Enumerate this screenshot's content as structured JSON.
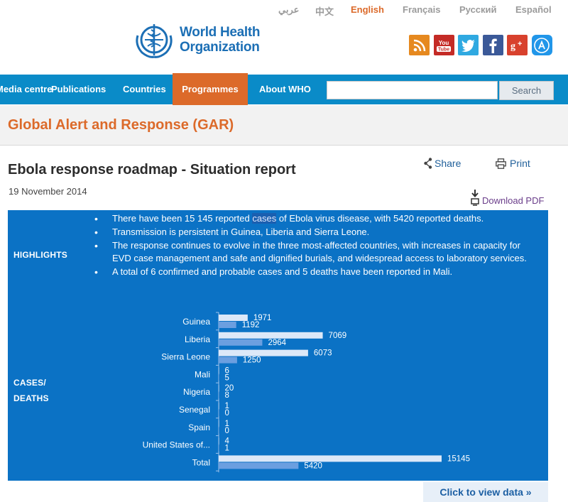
{
  "languages": [
    {
      "label": "عربي",
      "active": false
    },
    {
      "label": "中文",
      "active": false
    },
    {
      "label": "English",
      "active": true
    },
    {
      "label": "Français",
      "active": false
    },
    {
      "label": "Русский",
      "active": false
    },
    {
      "label": "Español",
      "active": false
    }
  ],
  "logo": {
    "line1": "World Health",
    "line2": "Organization"
  },
  "social": [
    {
      "icon": "rss-icon",
      "glyph": "◝"
    },
    {
      "icon": "youtube-icon",
      "glyph": "You"
    },
    {
      "icon": "twitter-icon",
      "glyph": "🐦"
    },
    {
      "icon": "facebook-icon",
      "glyph": "f"
    },
    {
      "icon": "google-plus-icon",
      "glyph": "g+"
    },
    {
      "icon": "app-store-icon",
      "glyph": "A"
    }
  ],
  "nav": {
    "items": [
      "Media centre",
      "Publications",
      "Countries",
      "Programmes",
      "About WHO"
    ],
    "active": "Programmes",
    "search_placeholder": "",
    "search_button": "Search"
  },
  "section_title": "Global Alert and Response (GAR)",
  "article": {
    "title": "Ebola response roadmap - Situation report",
    "date": "19 November 2014",
    "share": "Share",
    "print": "Print",
    "download": "Download PDF"
  },
  "highlights": {
    "label": "HIGHLIGHTS",
    "bullets": [
      {
        "before": "There have been 15 145 reported ",
        "highlight": "cases",
        "after": " of Ebola virus disease, with 5420 reported deaths."
      },
      {
        "before": "Transmission is persistent in Guinea, Liberia and Sierra Leone.",
        "highlight": "",
        "after": ""
      },
      {
        "before": "The response continues to evolve in the three most-affected countries, with increases in capacity for EVD case management and safe and dignified burials, and widespread access to laboratory services.",
        "highlight": "",
        "after": ""
      },
      {
        "before": "A total of 6 confirmed and probable cases and 5 deaths have been reported in Mali.",
        "highlight": "",
        "after": ""
      }
    ]
  },
  "cases_label_1": "CASES/",
  "cases_label_2": "DEATHS",
  "colors": {
    "cases_bar": "#dce8f8",
    "deaths_bar": "#6b9fe0",
    "panel": "#0b72c5",
    "accent": "#dc6a2a"
  },
  "chart_data": {
    "type": "bar",
    "orientation": "horizontal",
    "categories": [
      "Guinea",
      "Liberia",
      "Sierra Leone",
      "Mali",
      "Nigeria",
      "Senegal",
      "Spain",
      "United States of...",
      "Total"
    ],
    "series": [
      {
        "values": [
          1971,
          7069,
          6073,
          6,
          20,
          1,
          1,
          4,
          15145
        ]
      },
      {
        "values": [
          1192,
          2964,
          1250,
          5,
          8,
          0,
          0,
          1,
          5420
        ]
      }
    ],
    "title": "",
    "xlabel": "",
    "ylabel": ""
  },
  "view_data_link": "Click to view data »"
}
